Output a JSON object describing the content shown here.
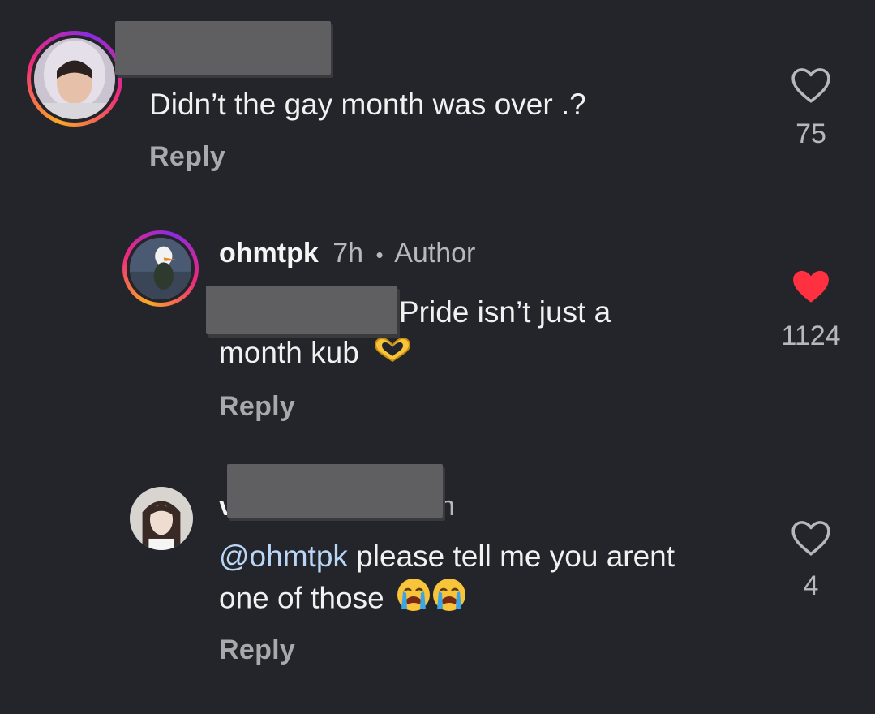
{
  "comments": [
    {
      "text": "Didn’t the gay month was over .?",
      "reply_label": "Reply",
      "likes": "75",
      "liked": false
    },
    {
      "username": "ohmtpk",
      "time": "7h",
      "separator": "•",
      "badge": "Author",
      "text_line1": "Pride isn’t just a",
      "text_line2": "month kub",
      "reply_label": "Reply",
      "likes": "1124",
      "liked": true
    },
    {
      "partial_left": "v",
      "partial_right": "h",
      "mention": "@ohmtpk",
      "text_line1": " please tell me you arent",
      "text_line2": "one of those",
      "reply_label": "Reply",
      "likes": "4",
      "liked": false
    }
  ],
  "icons": {
    "heart_outline": "heart-outline-icon",
    "heart_filled": "heart-filled-icon",
    "heart_hands_emoji": "heart-hands-emoji",
    "crying_emoji": "loudly-crying-emoji"
  },
  "colors": {
    "background": "#23252a",
    "liked_heart": "#ff3040",
    "mention": "#b9d6f6",
    "secondary_text": "#a8a8ad"
  }
}
